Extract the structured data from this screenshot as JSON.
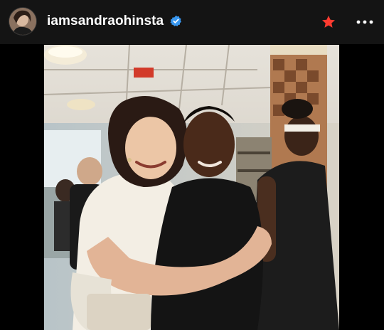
{
  "post": {
    "username": "iamsandraohinsta",
    "verified_icon": "verified-badge-icon",
    "favorite_icon": "star-icon",
    "more_icon": "more-horizontal-icon"
  },
  "colors": {
    "header_bg": "#141414",
    "verified_blue": "#3897f0",
    "star_red": "#ff3b30"
  }
}
